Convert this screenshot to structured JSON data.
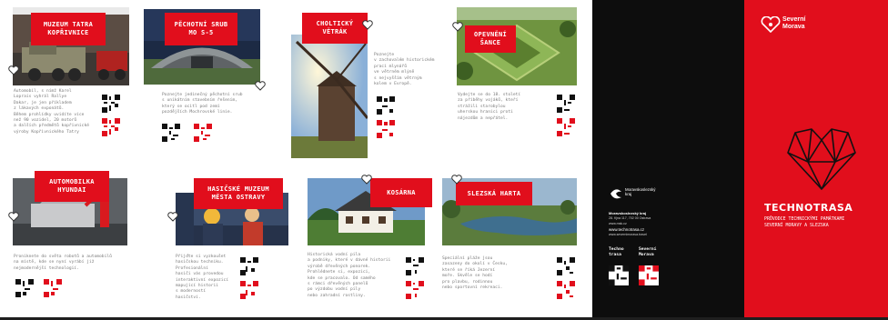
{
  "cards": [
    {
      "title": "MUZEUM TATRA\nKOPŘIVNICE",
      "description": "Automobil, s nímž Karel\nLoprais vyhrál Rallye\nDakar, je jen příkladem\nz lákavých exponátů.\nBěhem prohlídky uvidíte více\nnež 90 vozidel, 20 motorů\na dalších předmětů kopřivnické\nvýroby Kopřivnického Tatry"
    },
    {
      "title": "PĚCHOTNÍ SRUB\nMO S-5",
      "description": "Poznejte jedinečný pěchotní srub\ns unikátním stavebním řešením,\nkterý se ocitl pod zemí\npozdějších Mochrovské linie."
    },
    {
      "title": "CHOLTICKÝ\nVĚTRÁK",
      "description": "Poznejte\nv zachovalém historickém\nprací mlynářů\nve větrném mlýně\ns nejvyšším větrným\nkolem v Evropě."
    },
    {
      "title": "OPEVNĚNÍ\nŠANCE",
      "description": "Vydejte se do 18. století\nza příběhy vojáků, kteří\nstrážili starobylou\nuherskou hranici proti\nnájezdům a nepřátel."
    },
    {
      "title": "AUTOMOBILKA\nHYUNDAI",
      "description": "Proniknete do světa robotů a automobilů\nna místě, kde se nyní vyrábí již\nnejmodernější technologií."
    },
    {
      "title": "HASIČSKÉ MUZEUM\nMĚSTA OSTRAVY",
      "description": "Přijďte si vyzkoušet\nhasičskou techniku.\nProfesionální\nhasiči vás provedou\ninteraktivní expozicí\nmapující historii\ns moderností\nhasičství."
    },
    {
      "title": "KOSÁRNA",
      "description": "Historická vodní pila\na podniky, které v dávné historii\nvýrobě dřevěných ponorek.\nProhlédnete si, expozici,\nkde se pracovalo. Od samého\ns rámci dřevěných panelů\npo výzdobu vodní pily\nnebo zahradní rostliny."
    },
    {
      "title": "SLEZSKÁ HARTA",
      "description": "Speciální pláže jsou\nzasazeny do okolí v Česku,\nkteré se říká Jezerní\nmoře. Skvěle se hodí\npro plavbu, rodinnou\nnebo sportovní rekreaci."
    }
  ],
  "qr_labels": {
    "techno": "Techno\ntrasa",
    "severni": "Severní\nMorava"
  },
  "black_panel": {
    "org": "Moravskoslezský\nkraj",
    "address_title": "Moravskoslezský kraj",
    "address": "28. října 117, 702 00 Ostrava",
    "web1": "www.msk.cz",
    "web2": "www.technotrasa.cz",
    "web3": "www.severnimorava.travel",
    "qr1_label": "Techno\ntrasa",
    "qr2_label": "Severní\nMorava"
  },
  "red_panel": {
    "brand": "Severní\nMorava",
    "title": "TECHNOTRASA",
    "subtitle": "PRŮVODCE TECHNICKÝMI PAMÁTKAMI\nSEVERNÍ MORAVY A SLEZSKA"
  },
  "colors": {
    "accent": "#e10e1c",
    "dark": "#0d0d0d",
    "text_muted": "#7a7a7a"
  },
  "icons": [
    "heart-icon",
    "qr-code",
    "severni-morava-logo-icon",
    "msk-logo-icon",
    "heart-geometric-logo-icon"
  ]
}
